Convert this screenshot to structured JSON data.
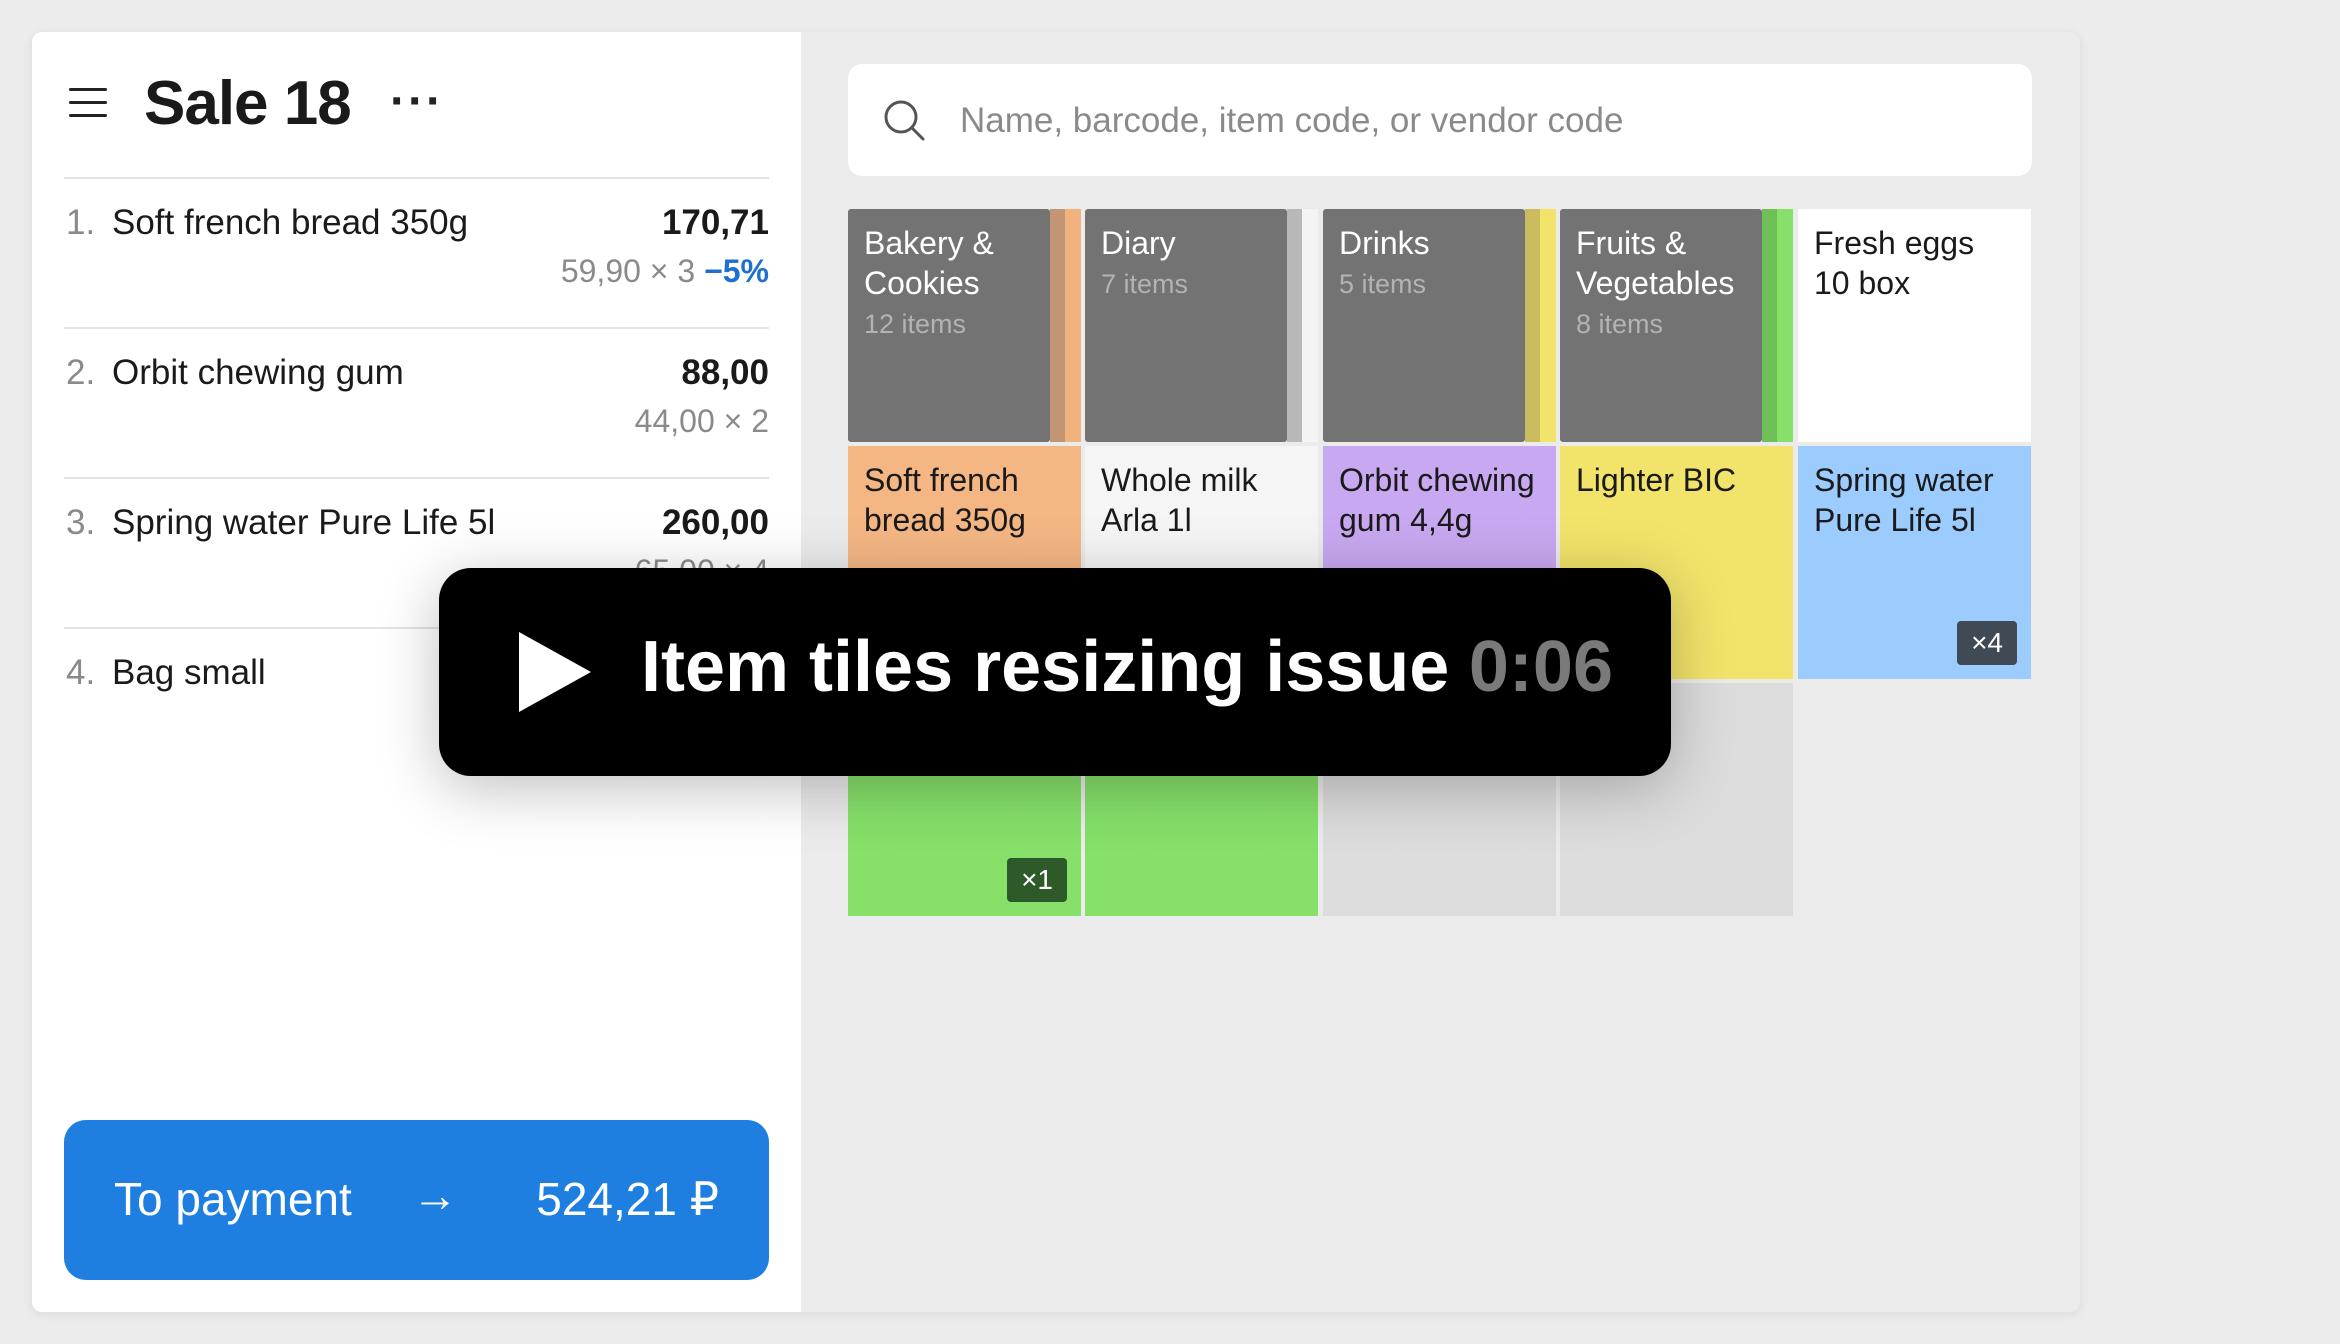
{
  "header": {
    "title": "Sale 18",
    "menu_icon": "hamburger-menu-icon",
    "more_icon": "more-dots-icon"
  },
  "items": [
    {
      "num": "1.",
      "name": "Soft french bread 350g",
      "price": "170,71",
      "detail": "59,90 × 3",
      "discount": "−5%"
    },
    {
      "num": "2.",
      "name": "Orbit chewing gum",
      "price": "88,00",
      "detail": "44,00 × 2"
    },
    {
      "num": "3.",
      "name": "Spring water Pure Life 5l",
      "price": "260,00",
      "detail": "65,00 × 4"
    },
    {
      "num": "4.",
      "name": "Bag small",
      "price": "",
      "detail": ""
    }
  ],
  "payment": {
    "label": "To payment",
    "total": "524,21 ₽",
    "arrow_icon": "arrow-right-icon"
  },
  "search": {
    "placeholder": "Name, barcode, item code, or vendor code",
    "icon": "search-icon"
  },
  "categories": [
    {
      "name": "Bakery & Cookies",
      "count": "12 items",
      "colors": [
        "#c29575",
        "#f2b27d"
      ]
    },
    {
      "name": "Diary",
      "count": "7 items",
      "colors": [
        "#b8b8b8",
        "#f4f4f4"
      ]
    },
    {
      "name": "Drinks",
      "count": "5 items",
      "colors": [
        "#cbbd5f",
        "#f2e36a"
      ]
    },
    {
      "name": "Fruits & Vegetables",
      "count": "8 items",
      "colors": [
        "#6fbf58",
        "#86e06a"
      ]
    }
  ],
  "products": [
    {
      "name": "Fresh eggs 10 box",
      "color": "#ffffff"
    },
    {
      "name": "Soft french bread 350g",
      "color": "#f4b784"
    },
    {
      "name": "Whole milk Arla 1l",
      "color": "#f5f5f5"
    },
    {
      "name": "Orbit chewing gum 4,4g",
      "color": "#c8a8f0"
    },
    {
      "name": "Lighter BIC",
      "color": "#f2e36a"
    },
    {
      "name": "Spring water Pure Life 5l",
      "color": "#9ccbfd",
      "badge": "×4"
    },
    {
      "name": "",
      "color": "#86e06a",
      "badge": "×1"
    },
    {
      "name": "",
      "color": "#86e06a"
    }
  ],
  "overlay": {
    "title": "Item tiles resizing issue",
    "time": "0:06",
    "icon": "play-icon"
  }
}
